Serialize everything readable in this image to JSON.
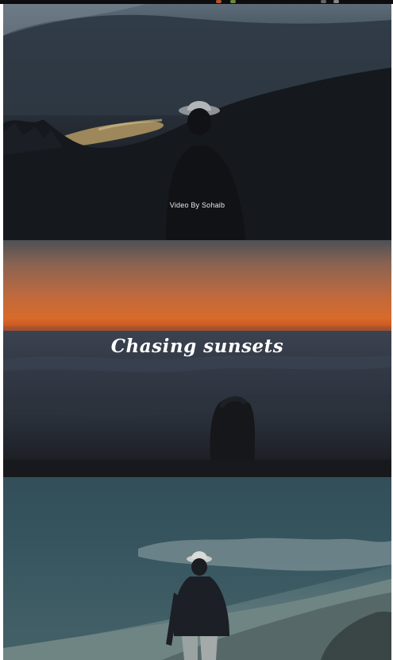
{
  "frames": [
    {
      "id": "frame-1",
      "caption": "Video By Sohaib"
    },
    {
      "id": "frame-2",
      "title": "Chasing sunsets"
    },
    {
      "id": "frame-3"
    }
  ],
  "colors": {
    "sunset_orange": "#d86a2a",
    "night_sky": "#2b333c",
    "sea_teal": "#3a5a63"
  }
}
